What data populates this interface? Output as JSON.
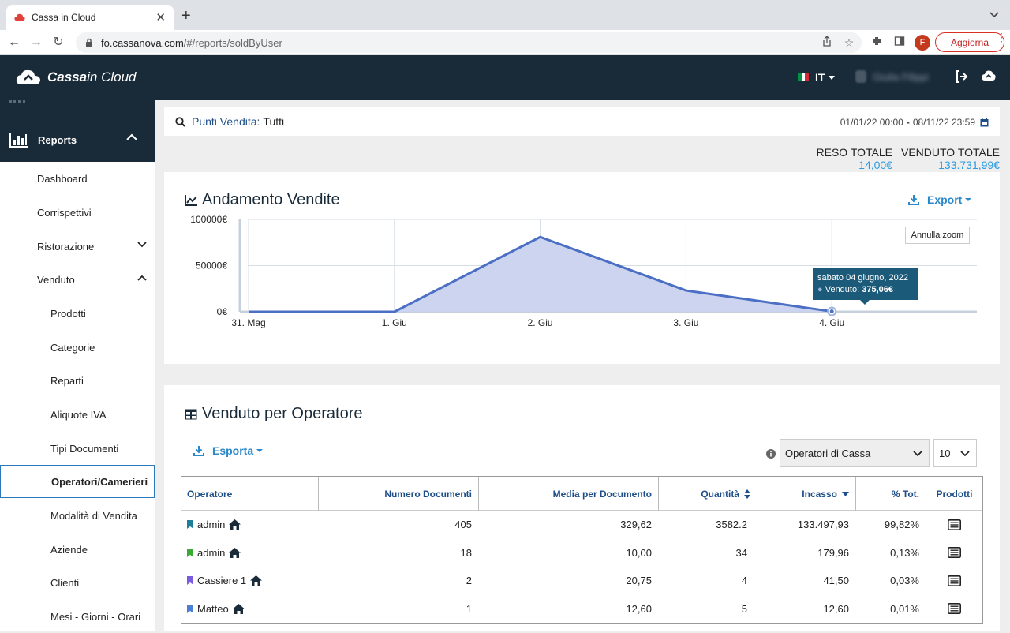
{
  "browser": {
    "tab_title": "Cassa in Cloud",
    "url_host": "fo.cassanova.com",
    "url_path": "/#/reports/soldByUser",
    "profile_initial": "F",
    "update_label": "Aggiorna"
  },
  "header": {
    "logo_bold": "Cassa",
    "logo_light": " in Cloud",
    "language": "IT",
    "user_name": "Giulia Filippi"
  },
  "sidebar": {
    "section": "Reports",
    "items": [
      {
        "label": "Dashboard"
      },
      {
        "label": "Corrispettivi"
      },
      {
        "label": "Ristorazione"
      },
      {
        "label": "Venduto"
      },
      {
        "label": "Prodotti"
      },
      {
        "label": "Categorie"
      },
      {
        "label": "Reparti"
      },
      {
        "label": "Aliquote IVA"
      },
      {
        "label": "Tipi Documenti"
      },
      {
        "label": "Operatori/Camerieri"
      },
      {
        "label": "Modalità di Vendita"
      },
      {
        "label": "Aziende"
      },
      {
        "label": "Clienti"
      },
      {
        "label": "Mesi - Giorni - Orari"
      }
    ]
  },
  "filter": {
    "label": "Punti Vendita:",
    "value": "Tutti",
    "date_from": "01/01/22 00:00",
    "date_to": "08/11/22 23:59"
  },
  "totals": {
    "reso_label": "RESO TOTALE",
    "reso_value": "14,00€",
    "venduto_label": "VENDUTO TOTALE",
    "venduto_value": "133.731,99€"
  },
  "sales_chart": {
    "title": "Andamento Vendite",
    "export_label": "Export",
    "reset_zoom_label": "Annulla zoom",
    "tooltip_date": "sabato 04 giugno, 2022",
    "tooltip_series": "Venduto:",
    "tooltip_value": "375,06€"
  },
  "chart_data": {
    "type": "area",
    "x": [
      "31. Mag",
      "1. Giu",
      "2. Giu",
      "3. Giu",
      "4. Giu"
    ],
    "series": [
      {
        "name": "Venduto",
        "values": [
          0,
          0,
          81000,
          23000,
          375.06
        ]
      }
    ],
    "y_ticks": [
      "0€",
      "50000€",
      "100000€"
    ],
    "ylim": [
      0,
      100000
    ],
    "grid": true,
    "color": "#4a6fc4"
  },
  "operators": {
    "title": "Venduto per Operatore",
    "export_label": "Esporta",
    "select_value": "Operatori di Cassa",
    "page_size": "10",
    "columns": [
      "Operatore",
      "Numero Documenti",
      "Media per Documento",
      "Quantità",
      "Incasso",
      "% Tot.",
      "Prodotti"
    ],
    "rows": [
      {
        "name": "admin",
        "color": "#1f7f9b",
        "docs": "405",
        "avg": "329,62",
        "qty": "3582.2",
        "income": "133.497,93",
        "pct": "99,82%"
      },
      {
        "name": "admin",
        "color": "#3aaa35",
        "docs": "18",
        "avg": "10,00",
        "qty": "34",
        "income": "179,96",
        "pct": "0,13%"
      },
      {
        "name": "Cassiere 1",
        "color": "#7b5ce0",
        "docs": "2",
        "avg": "20,75",
        "qty": "4",
        "income": "41,50",
        "pct": "0,03%"
      },
      {
        "name": "Matteo",
        "color": "#4a7fd4",
        "docs": "1",
        "avg": "12,60",
        "qty": "5",
        "income": "12,60",
        "pct": "0,01%"
      }
    ]
  }
}
